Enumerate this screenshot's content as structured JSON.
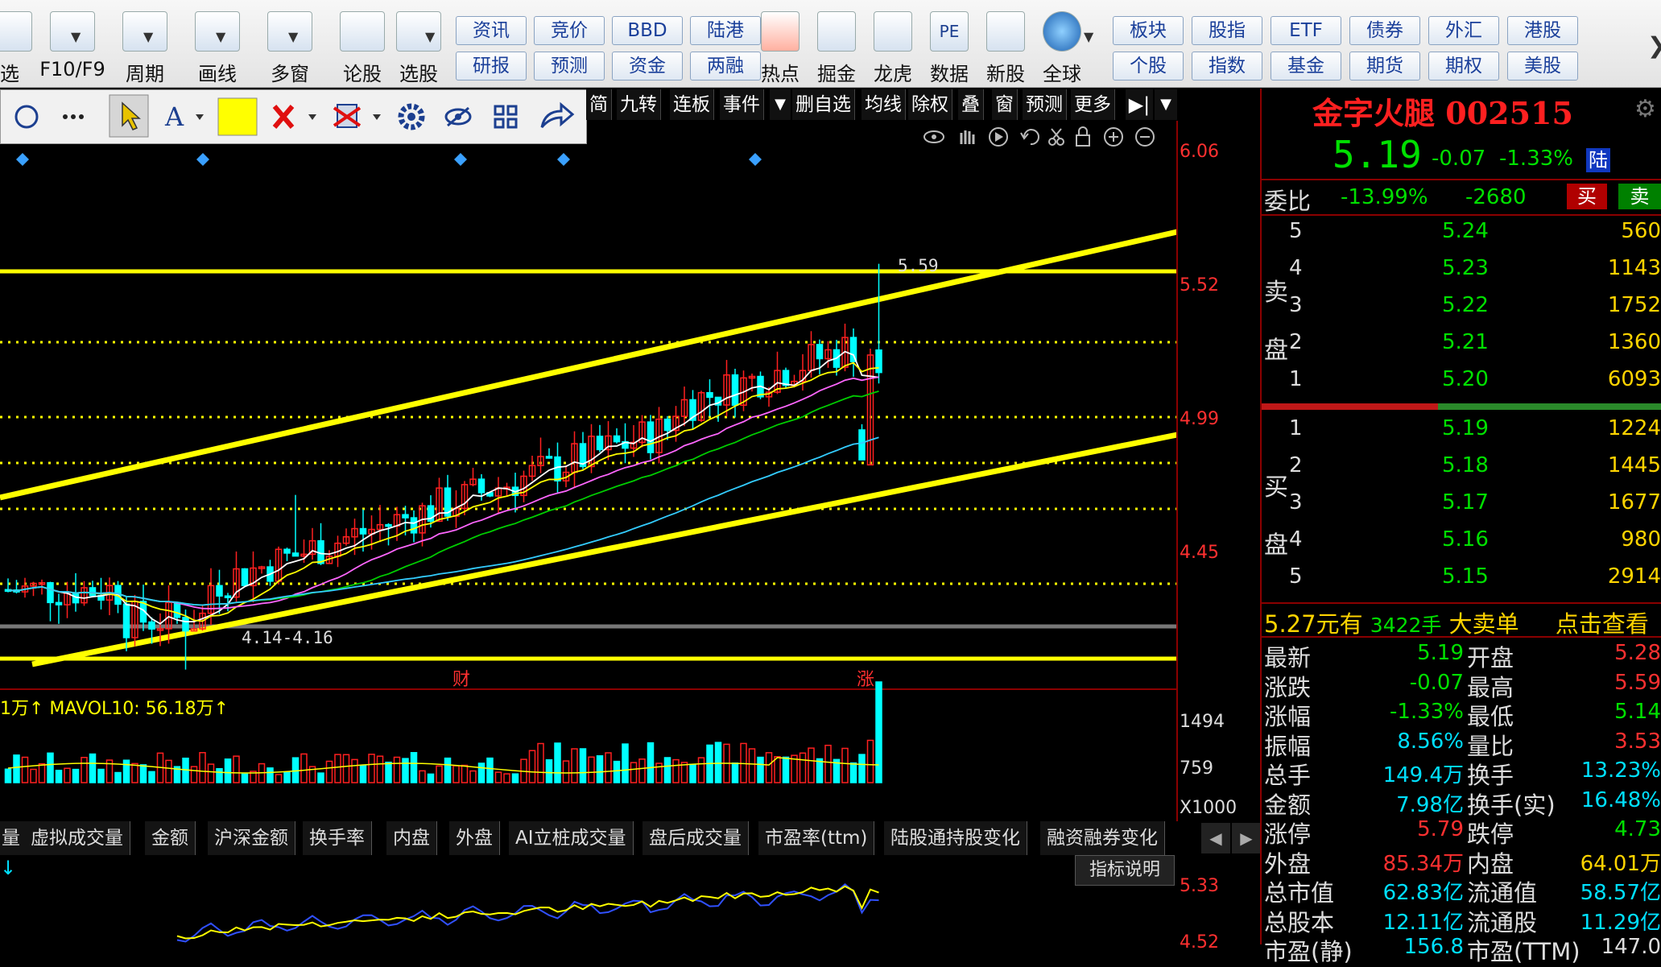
{
  "toolbar": {
    "tools": [
      {
        "label": "选",
        "icon": "select-stock-icon"
      },
      {
        "label": "F10/F9",
        "icon": "f10-icon"
      },
      {
        "label": "周期",
        "icon": "period-clock-icon"
      },
      {
        "label": "画线",
        "icon": "draw-pen-icon"
      },
      {
        "label": "多窗",
        "icon": "multi-window-icon"
      },
      {
        "label": "论股",
        "icon": "discuss-icon"
      },
      {
        "label": "选股",
        "icon": "stock-picker-icon"
      }
    ],
    "grid_buttons": [
      [
        "资讯",
        "研报"
      ],
      [
        "竞价",
        "预测"
      ],
      [
        "BBD",
        "资金"
      ],
      [
        "陆港",
        "两融"
      ]
    ],
    "feature_tools": [
      {
        "label": "热点",
        "icon": "hot-icon"
      },
      {
        "label": "掘金",
        "icon": "gold-icon"
      },
      {
        "label": "龙虎",
        "icon": "dragon-icon"
      },
      {
        "label": "数据",
        "icon": "pe-data-icon"
      },
      {
        "label": "新股",
        "icon": "ipo-icon"
      },
      {
        "label": "全球",
        "icon": "globe-icon"
      }
    ],
    "market_buttons": [
      [
        "板块",
        "个股"
      ],
      [
        "股指",
        "指数"
      ],
      [
        "ETF",
        "基金"
      ],
      [
        "债券",
        "期货"
      ],
      [
        "外汇",
        "期权"
      ],
      [
        "港股",
        "美股"
      ]
    ]
  },
  "chart_tabs": [
    "简",
    "九转",
    "连板",
    "事件",
    "删自选",
    "均线",
    "除权",
    "叠",
    "窗",
    "预测",
    "更多"
  ],
  "price_axis": [
    "6.06",
    "5.52",
    "4.99",
    "4.45"
  ],
  "annotations": {
    "high_label": "5.59",
    "low_label": "4.14-4.16",
    "event_cai": "财",
    "event_zhang": "涨"
  },
  "volume": {
    "legend": "1万↑  MAVOL10: 56.18万↑",
    "axis": [
      "1494",
      "759",
      "X1000"
    ]
  },
  "bottom_tabs": [
    "量",
    "虚拟成交量",
    "金额",
    "沪深金额",
    "换手率",
    "内盘",
    "外盘",
    "AI立桩成交量",
    "盘后成交量",
    "市盈率(ttm)",
    "陆股通持股变化",
    "融资融券变化"
  ],
  "indicator": {
    "button": "指标说明",
    "axis": [
      "5.33",
      "4.52"
    ]
  },
  "stock": {
    "name": "金字火腿",
    "code": "002515",
    "price": "5.19",
    "change": "-0.07",
    "change_pct": "-1.33%",
    "tag": "陆",
    "weibi_label": "委比",
    "weibi_pct": "-13.99%",
    "weibi_val": "-2680",
    "buy": "买",
    "sell": "卖",
    "sell_side_label": [
      "卖",
      "盘"
    ],
    "buy_side_label": [
      "买",
      "盘"
    ],
    "asks": [
      {
        "lv": "5",
        "p": "5.24",
        "v": "560"
      },
      {
        "lv": "4",
        "p": "5.23",
        "v": "1143"
      },
      {
        "lv": "3",
        "p": "5.22",
        "v": "1752"
      },
      {
        "lv": "2",
        "p": "5.21",
        "v": "1360"
      },
      {
        "lv": "1",
        "p": "5.20",
        "v": "6093"
      }
    ],
    "bids": [
      {
        "lv": "1",
        "p": "5.19",
        "v": "1224"
      },
      {
        "lv": "2",
        "p": "5.18",
        "v": "1445"
      },
      {
        "lv": "3",
        "p": "5.17",
        "v": "1677"
      },
      {
        "lv": "4",
        "p": "5.16",
        "v": "980"
      },
      {
        "lv": "5",
        "p": "5.15",
        "v": "2914"
      }
    ],
    "big_order": {
      "price": "5.27元有",
      "qty": "3422手",
      "text": "大卖单",
      "link": "点击查看"
    },
    "quotes": [
      {
        "l1": "最新",
        "v1": "5.19",
        "l2": "开盘",
        "v2": "5.28"
      },
      {
        "l1": "涨跌",
        "v1": "-0.07",
        "l2": "最高",
        "v2": "5.59"
      },
      {
        "l1": "涨幅",
        "v1": "-1.33%",
        "l2": "最低",
        "v2": "5.14"
      },
      {
        "l1": "振幅",
        "v1": "8.56%",
        "l2": "量比",
        "v2": "3.53"
      },
      {
        "l1": "总手",
        "v1": "149.4万",
        "l2": "换手",
        "v2": "13.23%"
      },
      {
        "l1": "金额",
        "v1": "7.98亿",
        "l2": "换手(实)",
        "v2": "16.48%"
      },
      {
        "l1": "涨停",
        "v1": "5.79",
        "l2": "跌停",
        "v2": "4.73"
      },
      {
        "l1": "外盘",
        "v1": "85.34万",
        "l2": "内盘",
        "v2": "64.01万"
      },
      {
        "l1": "总市值",
        "v1": "62.83亿",
        "l2": "流通值",
        "v2": "58.57亿"
      },
      {
        "l1": "总股本",
        "v1": "12.11亿",
        "l2": "流通股",
        "v2": "11.29亿"
      },
      {
        "l1": "市盈(静)",
        "v1": "156.8",
        "l2": "市盈(TTM)",
        "v2": "147.0"
      }
    ]
  },
  "colors": {
    "up": "#ff2020",
    "down": "#00ffff",
    "ma5": "#ffffff",
    "ma10": "#ffff00",
    "ma20": "#ff66ff",
    "ma30": "#00cc00",
    "ma60": "#33ccff",
    "trend": "#ffff00"
  }
}
